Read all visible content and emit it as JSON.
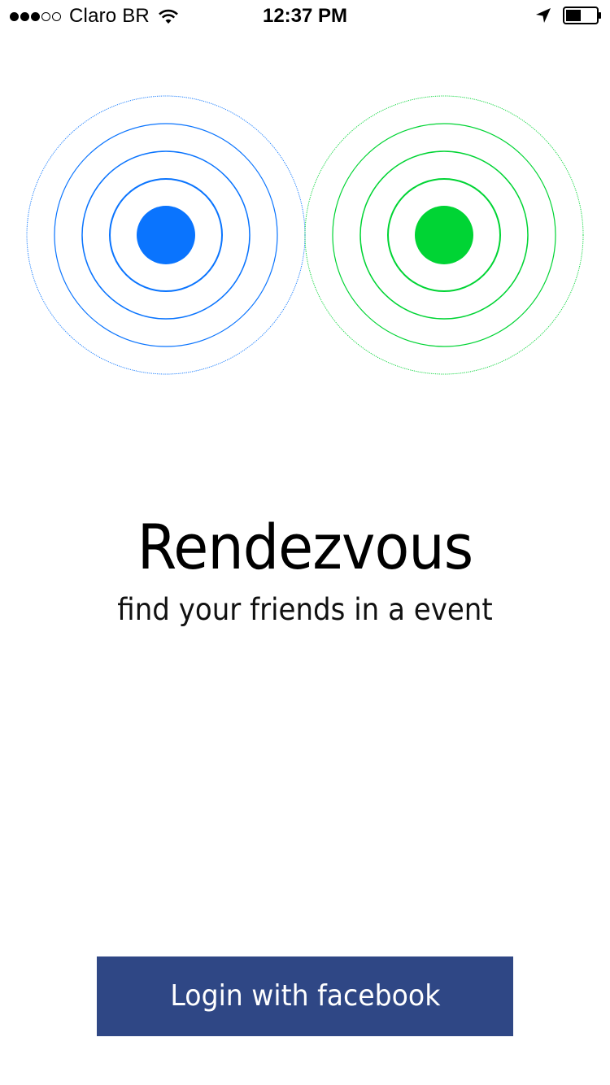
{
  "status_bar": {
    "signal_filled": 3,
    "signal_total": 5,
    "carrier": "Claro BR",
    "time": "12:37 PM",
    "battery_percent": 50,
    "icons": [
      "wifi-icon",
      "location-arrow-icon",
      "battery-icon"
    ]
  },
  "radar": {
    "left_color": "#0a74fe",
    "right_color": "#00d434"
  },
  "app": {
    "title": "Rendezvous",
    "tagline": "find your friends in a event"
  },
  "login": {
    "label": "Login with facebook",
    "color": "#2f4785"
  }
}
